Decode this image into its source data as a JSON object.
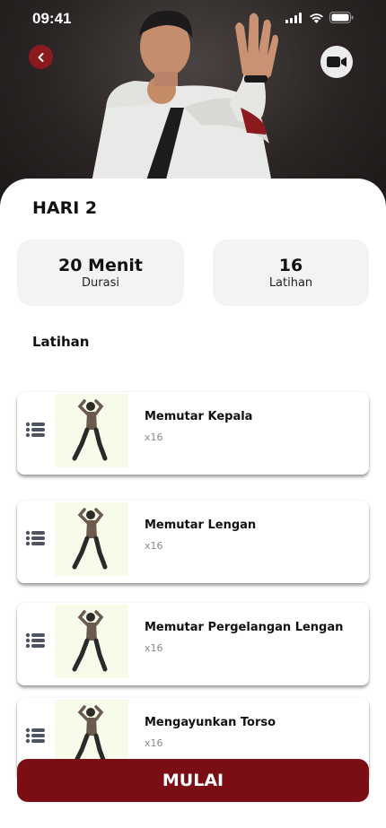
{
  "status_bar": {
    "time": "09:41"
  },
  "header": {
    "back_icon": "chevron-left-icon",
    "video_icon": "video-camera-icon"
  },
  "workout": {
    "title": "HARI 2",
    "duration": {
      "value": "20 Menit",
      "label": "Durasi"
    },
    "count": {
      "value": "16",
      "label": "Latihan"
    }
  },
  "section_title": "Latihan",
  "exercises": [
    {
      "name": "Memutar Kepala",
      "reps": "x16"
    },
    {
      "name": "Memutar Lengan",
      "reps": "x16"
    },
    {
      "name": "Memutar Pergelangan Lengan",
      "reps": "x16"
    },
    {
      "name": "Mengayunkan Torso",
      "reps": "x16"
    }
  ],
  "start_button": "MULAI",
  "colors": {
    "accent": "#7a0e14",
    "back_button": "#8b1a1f",
    "card_bg": "#f2f3f5",
    "thumb_bg": "#f8fbea"
  }
}
